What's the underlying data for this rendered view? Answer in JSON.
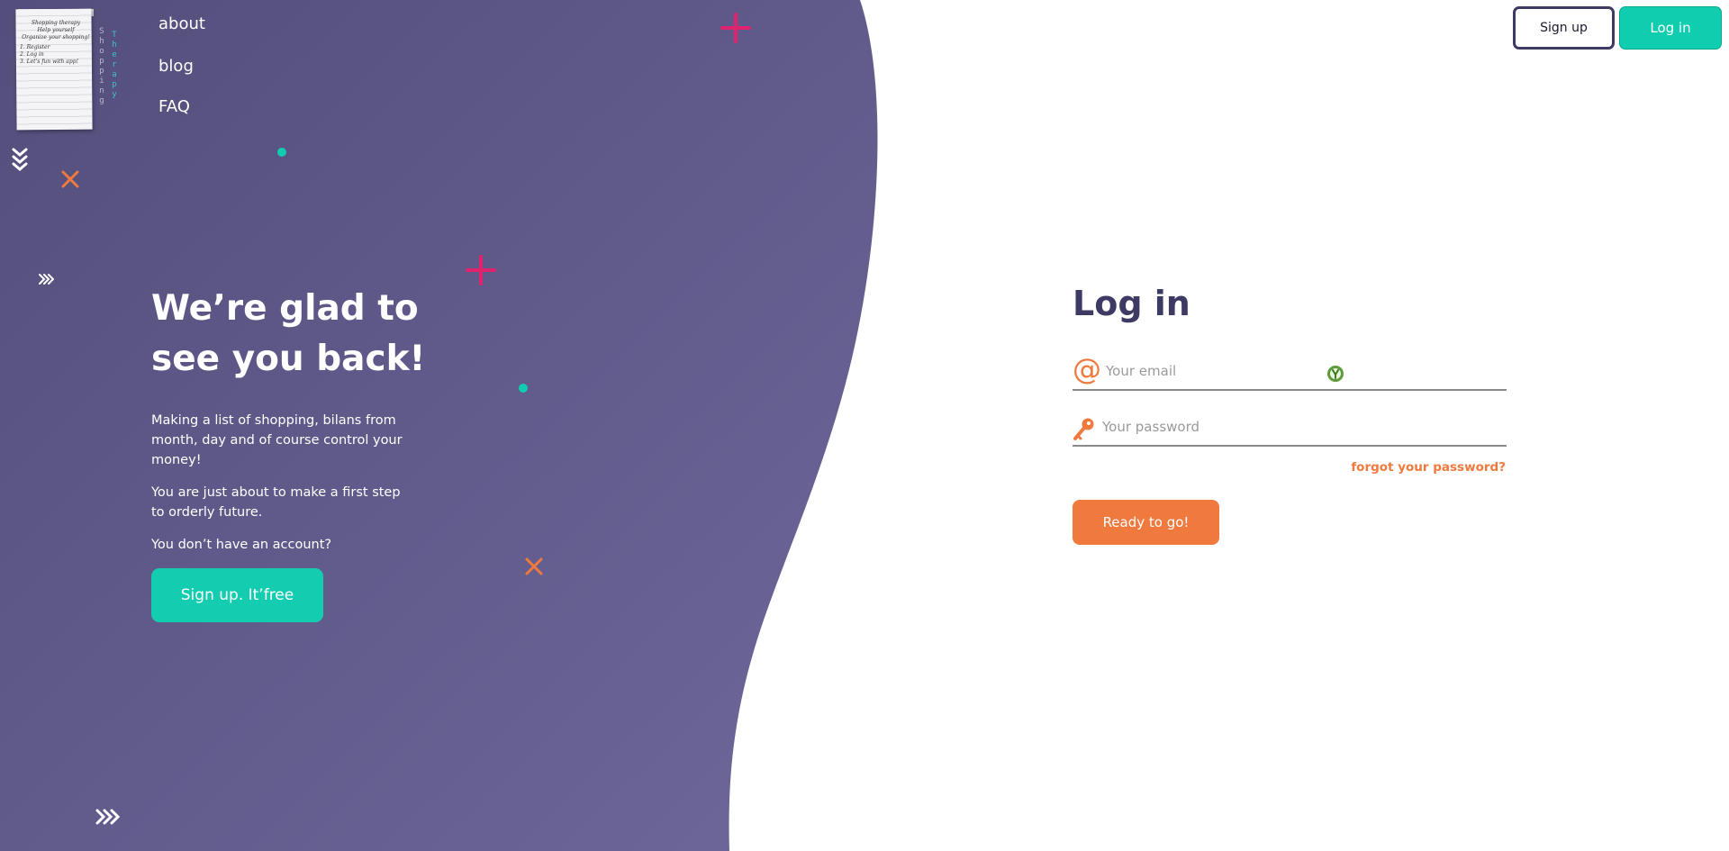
{
  "brand": {
    "note_lines": [
      "Shopping therapy",
      "Help yourself",
      "Organize your shopping!",
      "1. Register",
      "2. Log in",
      "3. Let's fun with app!"
    ],
    "vertical_word_1": "Shopping",
    "vertical_word_2": "Therapy"
  },
  "nav": {
    "items": [
      {
        "label": "about"
      },
      {
        "label": "blog"
      },
      {
        "label": "FAQ"
      }
    ]
  },
  "header": {
    "signup_label": "Sign up",
    "login_label": "Log in"
  },
  "hero": {
    "title_line1": "We’re glad to",
    "title_line2": "see you back!",
    "paragraph1": "Making a list of shopping, bilans from month, day and of course control your money!",
    "paragraph2": "You are just about to make a first step to orderly future.",
    "paragraph3": "You don’t have an account?",
    "cta_label": "Sign up. It’free"
  },
  "login": {
    "title": "Log in",
    "email_placeholder": "Your email",
    "password_placeholder": "Your password",
    "forgot_label": "forgot your password?",
    "submit_label": "Ready to go!"
  },
  "colors": {
    "panel_start": "#544e7c",
    "panel_end": "#6c6699",
    "teal": "#11cdb0",
    "orange": "#f07a3d",
    "pink": "#e0236e",
    "navy": "#3d3a63"
  }
}
